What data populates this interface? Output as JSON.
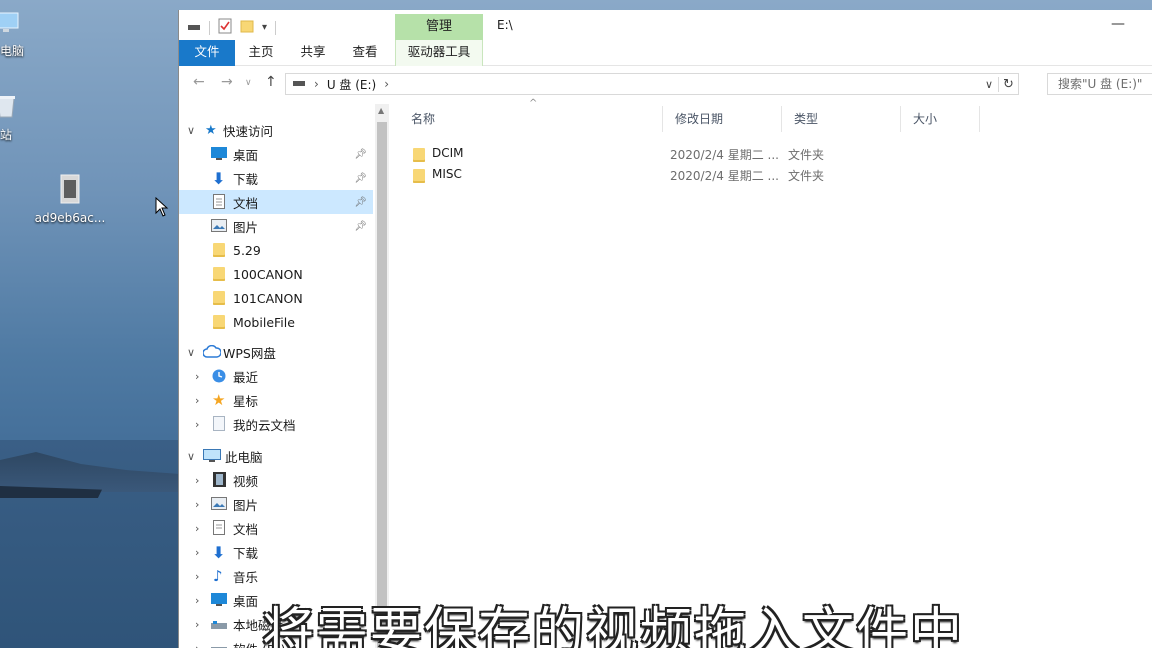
{
  "desktop": {
    "icons": [
      {
        "label": "电脑",
        "icon": "monitor-icon"
      },
      {
        "label": "站",
        "icon": "recycle-bin-icon"
      },
      {
        "label": "ad9eb6ac...",
        "icon": "image-file-icon"
      }
    ]
  },
  "window": {
    "title": "E:\\",
    "contextual_tab": "管理",
    "ribbon_tabs": [
      "文件",
      "主页",
      "共享",
      "查看",
      "驱动器工具"
    ],
    "minimize_glyph": "—"
  },
  "address": {
    "segments": [
      "U 盘 (E:)"
    ],
    "search_placeholder": "搜索\"U 盘 (E:)\""
  },
  "nav": {
    "quick_access": "快速访问",
    "quick_items": [
      {
        "label": "桌面",
        "icon": "desktop-icon",
        "pinned": true
      },
      {
        "label": "下载",
        "icon": "download-icon",
        "pinned": true
      },
      {
        "label": "文档",
        "icon": "document-icon",
        "pinned": true,
        "selected": true
      },
      {
        "label": "图片",
        "icon": "picture-icon",
        "pinned": true
      },
      {
        "label": "5.29",
        "icon": "folder-icon"
      },
      {
        "label": "100CANON",
        "icon": "folder-icon"
      },
      {
        "label": "101CANON",
        "icon": "folder-icon"
      },
      {
        "label": "MobileFile",
        "icon": "folder-icon"
      }
    ],
    "wps": "WPS网盘",
    "wps_items": [
      {
        "label": "最近",
        "icon": "clock-icon"
      },
      {
        "label": "星标",
        "icon": "star-icon"
      },
      {
        "label": "我的云文档",
        "icon": "cloud-doc-icon"
      }
    ],
    "this_pc": "此电脑",
    "pc_items": [
      {
        "label": "视频",
        "icon": "video-icon"
      },
      {
        "label": "图片",
        "icon": "picture-icon"
      },
      {
        "label": "文档",
        "icon": "document-icon"
      },
      {
        "label": "下载",
        "icon": "download-icon"
      },
      {
        "label": "音乐",
        "icon": "music-icon"
      },
      {
        "label": "桌面",
        "icon": "desktop-icon"
      },
      {
        "label": "本地磁盘",
        "icon": "drive-icon"
      },
      {
        "label": "软件 (D:)",
        "icon": "drive-icon"
      }
    ]
  },
  "files": {
    "columns": [
      "名称",
      "修改日期",
      "类型",
      "大小"
    ],
    "rows": [
      {
        "name": "DCIM",
        "date": "2020/2/4 星期二 ...",
        "type": "文件夹",
        "size": ""
      },
      {
        "name": "MISC",
        "date": "2020/2/4 星期二 ...",
        "type": "文件夹",
        "size": ""
      }
    ]
  },
  "subtitle": "将需要保存的视频拖入文件中",
  "colors": {
    "file_tab": "#1979ca",
    "manage_tab": "#b6e1a9",
    "selection": "#cce8ff",
    "folder": "#f8d775"
  }
}
